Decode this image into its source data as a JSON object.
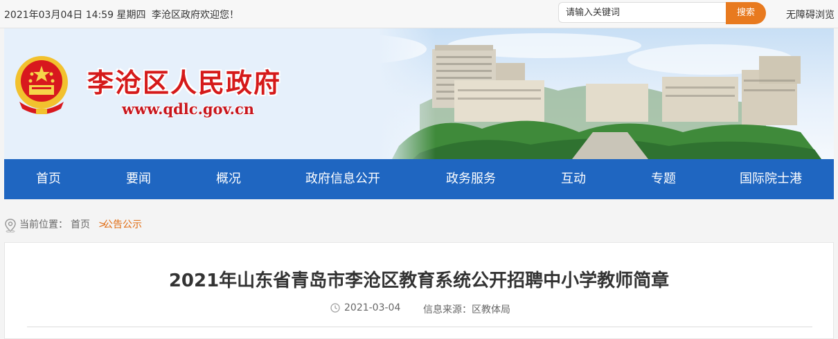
{
  "topbar": {
    "date": "2021年03月04日 14:59 星期四",
    "welcome": "李沧区政府欢迎您！",
    "search_placeholder": "请输入关键词",
    "search_button": "搜索",
    "accessibility": "无障碍浏览"
  },
  "banner": {
    "title": "李沧区人民政府",
    "url": "www.qdlc.gov.cn"
  },
  "nav": {
    "items": [
      "首页",
      "要闻",
      "概况",
      "政府信息公开",
      "政务服务",
      "互动",
      "专题",
      "国际院士港"
    ]
  },
  "breadcrumb": {
    "label": "当前位置：",
    "home": "首页",
    "separator": ">",
    "current": "公告公示"
  },
  "article": {
    "title": "2021年山东省青岛市李沧区教育系统公开招聘中小学教师简章",
    "date": "2021-03-04",
    "source": "信息来源：区教体局"
  },
  "colors": {
    "nav_blue": "#1f66c1",
    "accent_orange": "#e87a1f",
    "title_red": "#d51a1a"
  },
  "icons": [
    "national-emblem-icon",
    "location-pin-icon",
    "clock-icon"
  ]
}
